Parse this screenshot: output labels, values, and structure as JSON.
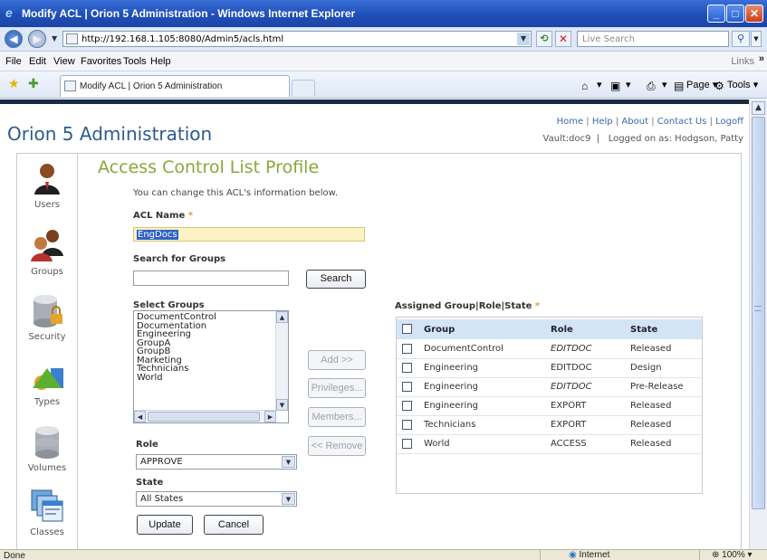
{
  "window": {
    "title": "Modify ACL | Orion 5 Administration - Windows Internet Explorer",
    "minimize": "_",
    "maximize": "□",
    "close": "✕"
  },
  "address_bar": {
    "url": "http://192.168.1.105:8080/Admin5/acls.html",
    "search_placeholder": "Live Search"
  },
  "menu": {
    "items": [
      "File",
      "Edit",
      "View",
      "Favorites",
      "Tools",
      "Help"
    ],
    "links": "Links"
  },
  "tabs": {
    "active_tab": "Modify ACL | Orion 5 Administration"
  },
  "command_bar": {
    "page": "Page",
    "tools": "Tools"
  },
  "app": {
    "name": "Orion 5 Administration",
    "top_links": [
      "Home",
      "Help",
      "About",
      "Contact Us",
      "Logoff"
    ],
    "vault": "Vault:doc9",
    "logged_on": "Logged on as: Hodgson, Patty"
  },
  "sidebar": {
    "items": [
      {
        "label": "Users",
        "icon": "user-icon"
      },
      {
        "label": "Groups",
        "icon": "group-icon"
      },
      {
        "label": "Security",
        "icon": "database-lock-icon"
      },
      {
        "label": "Types",
        "icon": "shapes-icon"
      },
      {
        "label": "Volumes",
        "icon": "database-icon"
      },
      {
        "label": "Classes",
        "icon": "windows-icon"
      }
    ]
  },
  "page": {
    "title": "Access Control List Profile",
    "intro": "You can change this ACL's information below.",
    "acl_name_label": "ACL Name",
    "acl_name_value": "EngDocs",
    "required_mark": "*",
    "search_groups_label": "Search for Groups",
    "search_groups_value": "",
    "search_button": "Search",
    "select_groups_label": "Select Groups",
    "groups": [
      "DocumentControl",
      "Documentation",
      "Engineering",
      "GroupA",
      "GroupB",
      "Marketing",
      "Technicians",
      "World"
    ],
    "add_button": "Add >>",
    "privileges_button": "Privileges...",
    "members_button": "Members...",
    "remove_button": "<< Remove",
    "role_label": "Role",
    "role_value": "APPROVE",
    "state_label": "State",
    "state_value": "All States",
    "update_button": "Update",
    "cancel_button": "Cancel",
    "assigned_label": "Assigned Group|Role|State",
    "assigned_columns": [
      "Group",
      "Role",
      "State"
    ],
    "assigned_rows": [
      {
        "group": "DocumentControl",
        "role": "EDITDOC",
        "state": "Released",
        "role_italic": true
      },
      {
        "group": "Engineering",
        "role": "EDITDOC",
        "state": "Design",
        "role_italic": false
      },
      {
        "group": "Engineering",
        "role": "EDITDOC",
        "state": "Pre-Release",
        "role_italic": true
      },
      {
        "group": "Engineering",
        "role": "EXPORT",
        "state": "Released",
        "role_italic": false
      },
      {
        "group": "Technicians",
        "role": "EXPORT",
        "state": "Released",
        "role_italic": false
      },
      {
        "group": "World",
        "role": "ACCESS",
        "state": "Released",
        "role_italic": false
      }
    ]
  },
  "status_bar": {
    "status": "Done",
    "zone": "Internet",
    "zoom": "100%"
  }
}
